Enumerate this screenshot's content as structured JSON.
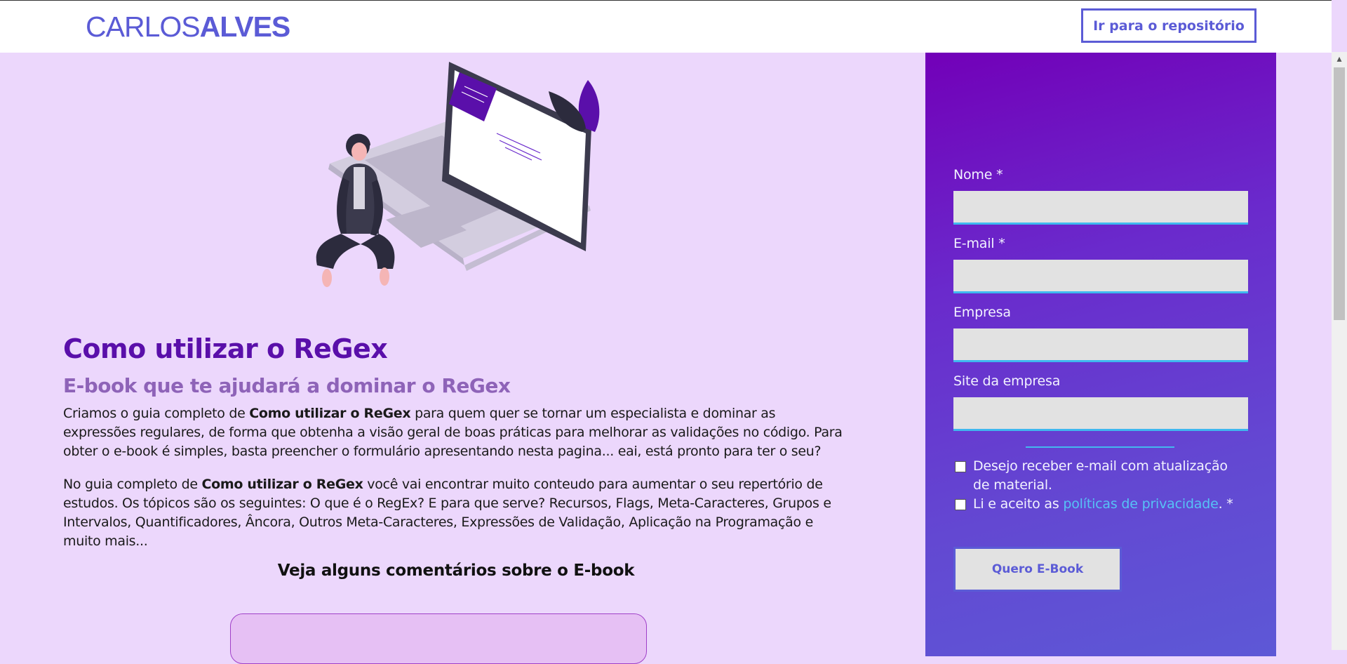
{
  "header": {
    "logo_light": "CARLOS",
    "logo_bold": "ALVES",
    "repo_button": "Ir para o repositório"
  },
  "main": {
    "title": "Como utilizar o ReGex",
    "subtitle": "E-book que te ajudará a dominar o ReGex",
    "p1": {
      "before": "Criamos o guia completo de ",
      "bold": "Como utilizar o ReGex",
      "after": " para quem quer se tornar um especialista e dominar as expressões regulares, de forma que obtenha a visão geral de boas práticas para melhorar as validações no código. Para obter o e-book é simples, basta preencher o formulário apresentando nesta pagina... eai, está pronto para ter o seu?"
    },
    "p2": {
      "before": "No guia completo de ",
      "bold": "Como utilizar o ReGex",
      "after": " você vai encontrar muito conteudo para aumentar o seu repertório de estudos. Os tópicos são os seguintes: O que é o RegEx? E para que serve? Recursos, Flags, Meta-Caracteres, Grupos e Intervalos, Quantificadores, Âncora, Outros Meta-Caracteres, Expressões de Validação, Aplicação na Programação e muito mais..."
    },
    "comments_title": "Veja alguns comentários sobre o E-book"
  },
  "form": {
    "fields": [
      {
        "label": "Nome *",
        "value": ""
      },
      {
        "label": "E-mail *",
        "value": ""
      },
      {
        "label": "Empresa",
        "value": ""
      },
      {
        "label": "Site da empresa",
        "value": ""
      }
    ],
    "newsletter_label": "Desejo receber e-mail com atualização de material.",
    "privacy_before": "Li e aceito as ",
    "privacy_link": "políticas de privacidade",
    "privacy_after": ". *",
    "submit": "Quero E-Book"
  },
  "colors": {
    "brand": "#5b5bd6",
    "title": "#5a0faa",
    "page_bg": "#ecd7fc",
    "accent_line": "#3fb8ef"
  }
}
